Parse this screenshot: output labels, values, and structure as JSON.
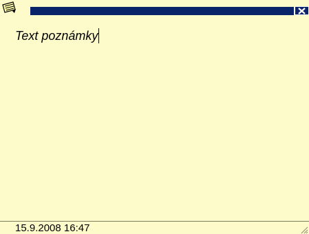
{
  "note": {
    "icon": "note-pad-icon",
    "close_icon": "close-icon",
    "body_text": "Text poznámky",
    "timestamp": "15.9.2008 16:47",
    "colors": {
      "background": "#fefbca",
      "title_bar": "#0a246a",
      "text": "#000000"
    }
  }
}
